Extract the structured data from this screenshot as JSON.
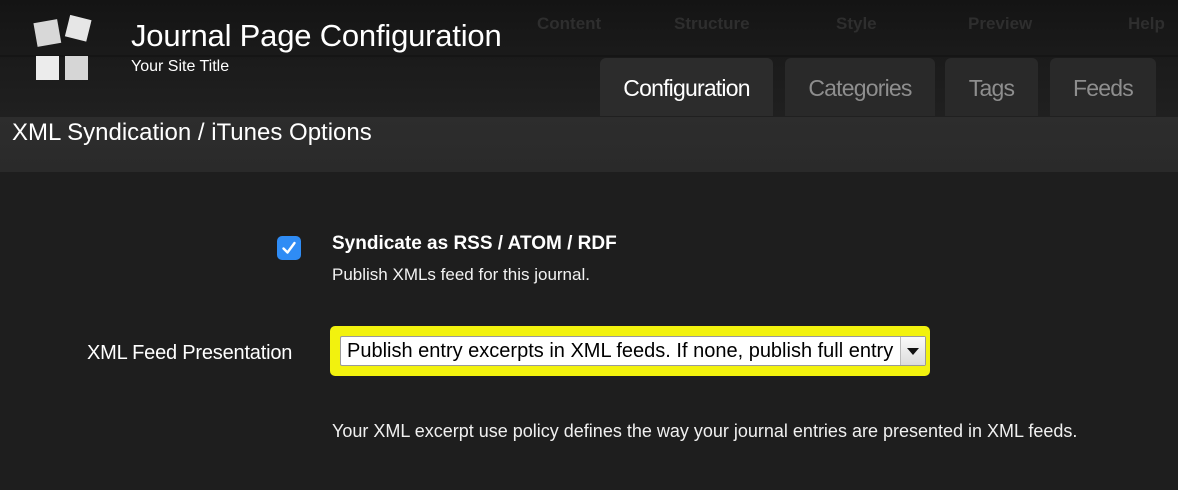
{
  "header": {
    "title": "Journal Page Configuration",
    "subtitle": "Your Site Title",
    "background_nav": [
      "Content",
      "Structure",
      "Style",
      "Preview",
      "Help"
    ]
  },
  "tabs": [
    {
      "label": "Configuration",
      "active": true
    },
    {
      "label": "Categories",
      "active": false
    },
    {
      "label": "Tags",
      "active": false
    },
    {
      "label": "Feeds",
      "active": false
    }
  ],
  "section": {
    "title": "XML Syndication / iTunes Options"
  },
  "syndicate": {
    "checked": true,
    "label": "Syndicate as RSS / ATOM / RDF",
    "help": "Publish XMLs feed for this journal."
  },
  "feed_presentation": {
    "label": "XML Feed Presentation",
    "selected": "Publish entry excerpts in XML feeds. If none, publish full entry",
    "help": "Your XML excerpt use policy defines the way your journal entries are presented in XML feeds."
  },
  "colors": {
    "highlight": "#f2f20e",
    "checkbox": "#2f8cf5",
    "background": "#1e1e1e"
  },
  "icons": {
    "logo": "app-logo-icon",
    "checkmark": "checkmark-icon",
    "dropdown": "chevron-down-icon"
  }
}
